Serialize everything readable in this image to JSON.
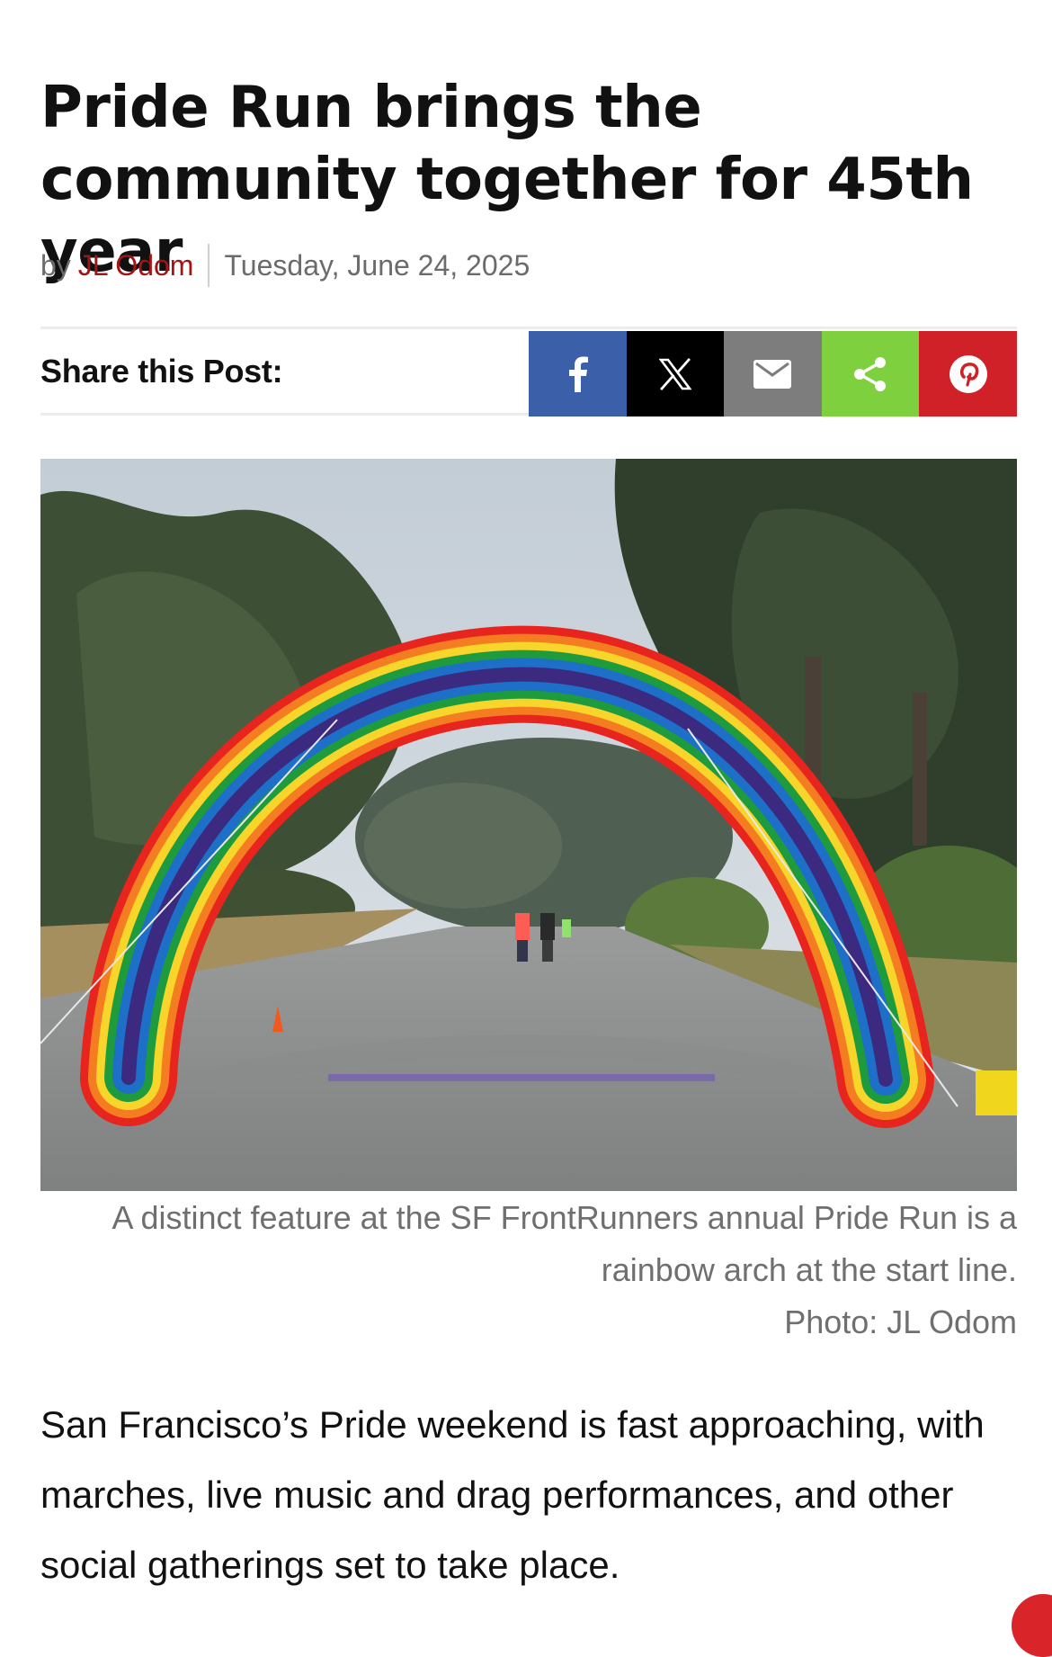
{
  "article": {
    "headline": "Pride Run brings the community together for 45th year",
    "byline_prefix": "by",
    "author": "JL Odom",
    "date": "Tuesday, June 24, 2025"
  },
  "share": {
    "label": "Share this Post:",
    "buttons": [
      {
        "network": "Facebook",
        "icon": "facebook-icon",
        "color": "#3b5fa8"
      },
      {
        "network": "X",
        "icon": "x-icon",
        "color": "#000000"
      },
      {
        "network": "Email",
        "icon": "email-icon",
        "color": "#7d7d7d"
      },
      {
        "network": "Share",
        "icon": "share-icon",
        "color": "#7fd03f"
      },
      {
        "network": "Pinterest",
        "icon": "pinterest-icon",
        "color": "#cf2127"
      }
    ]
  },
  "photo": {
    "caption_line1": "A distinct feature at the SF FrontRunners annual Pride Run is a",
    "caption_line2": "rainbow arch at the start line.",
    "credit": "Photo: JL Odom"
  },
  "body": {
    "paragraph1": "San Francisco’s Pride weekend is fast approaching, with marches, live music and drag performances, and other social gatherings set to take place."
  },
  "colors": {
    "author_link": "#a31515",
    "meta_text": "#6b6b6b",
    "caption_text": "#6f6f6f"
  }
}
